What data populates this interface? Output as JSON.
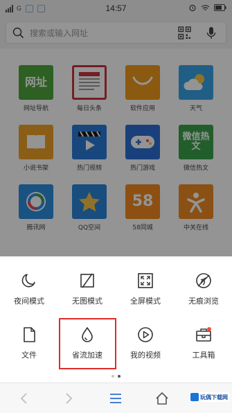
{
  "status_bar": {
    "carrier": "G",
    "time": "14:57"
  },
  "search": {
    "placeholder": "搜索或输入网址"
  },
  "apps": [
    {
      "label": "网址导航",
      "tile_text": "网址",
      "color": "#4fa63c",
      "icon": "web-address-icon"
    },
    {
      "label": "每日头条",
      "tile_text": "",
      "color": "#c8343f",
      "icon": "news-icon"
    },
    {
      "label": "软件应用",
      "tile_text": "",
      "color": "#f09a1a",
      "icon": "shopping-bag-icon"
    },
    {
      "label": "天气",
      "tile_text": "",
      "color": "#39a3e6",
      "icon": "weather-icon"
    },
    {
      "label": "小说书架",
      "tile_text": "",
      "color": "#f0a22a",
      "icon": "book-icon"
    },
    {
      "label": "热门视频",
      "tile_text": "",
      "color": "#2a7ad8",
      "icon": "video-icon"
    },
    {
      "label": "热门游戏",
      "tile_text": "",
      "color": "#2d6fd6",
      "icon": "gamepad-icon"
    },
    {
      "label": "微信热文",
      "tile_text": "微信热文",
      "color": "#3aa24b",
      "icon": "wechat-icon"
    },
    {
      "label": "腾讯网",
      "tile_text": "",
      "color": "#2e8de0",
      "icon": "tencent-icon"
    },
    {
      "label": "QQ空间",
      "tile_text": "",
      "color": "#2a86d8",
      "icon": "star-icon"
    },
    {
      "label": "58同城",
      "tile_text": "58",
      "color": "#f38a1f",
      "icon": "58-icon"
    },
    {
      "label": "中关在线",
      "tile_text": "",
      "color": "#f08b24",
      "icon": "zol-icon"
    }
  ],
  "menu": {
    "items": [
      {
        "label": "夜间模式",
        "icon": "moon-icon"
      },
      {
        "label": "无图模式",
        "icon": "no-image-icon"
      },
      {
        "label": "全屏模式",
        "icon": "fullscreen-icon"
      },
      {
        "label": "无痕浏览",
        "icon": "incognito-icon"
      },
      {
        "label": "文件",
        "icon": "file-icon"
      },
      {
        "label": "省流加速",
        "icon": "droplet-icon"
      },
      {
        "label": "我的视频",
        "icon": "play-circle-icon"
      },
      {
        "label": "工具箱",
        "icon": "toolbox-icon"
      }
    ],
    "page_indicator": {
      "current": 2,
      "total": 2
    }
  },
  "bottom_nav": {
    "watermark": "玩偶下载网"
  },
  "colors": {
    "highlight": "#e02a2a",
    "overlay": "rgba(0,0,0,0.42)"
  }
}
